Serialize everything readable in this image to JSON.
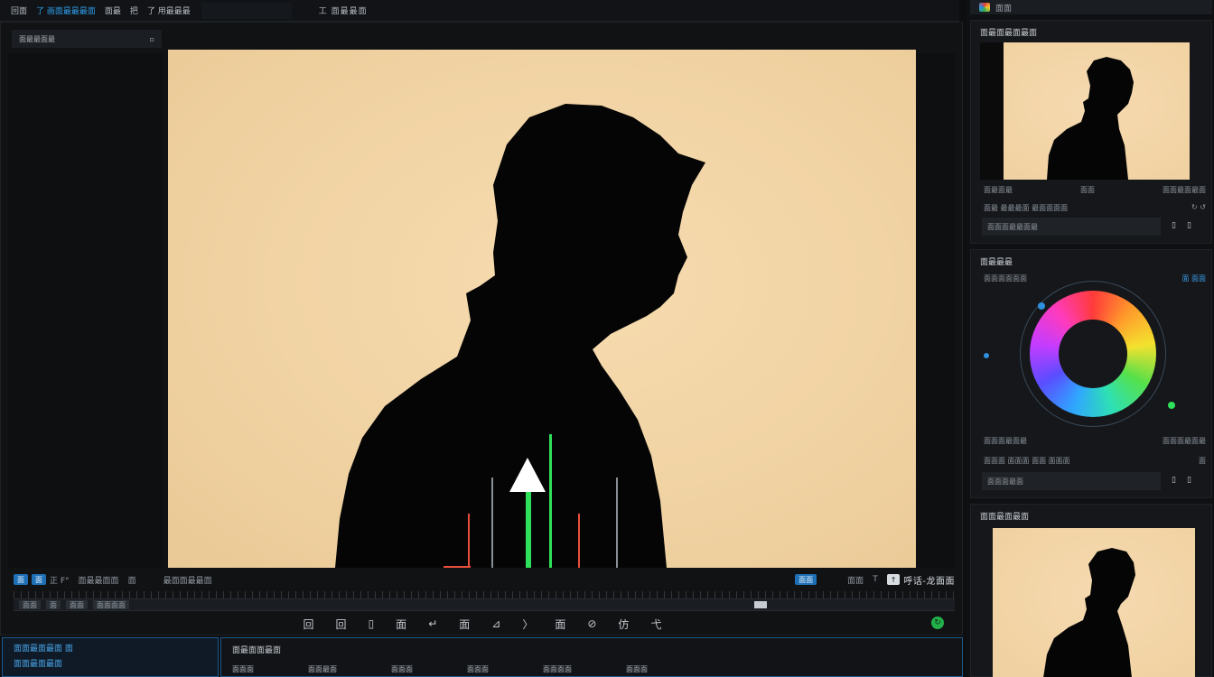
{
  "topbar": {
    "menu": [
      "回面",
      "了 画面最最最面",
      "面最",
      "把",
      "了 用最最最",
      "工 面最最面"
    ],
    "highlight_index": 1
  },
  "viewer": {
    "tab_label": "面最最面最",
    "tab_close": "▫"
  },
  "transport": {
    "chips": [
      "面",
      "面"
    ],
    "labels": [
      "正 F°",
      "面最最面面",
      "面",
      "最面面最最面"
    ],
    "zoom_chip": "面面",
    "right_label": "面面",
    "speed_icon": "T",
    "speed_value": "↑",
    "timecode": "呼话-龙面面",
    "scrub_segments": [
      "面面",
      "面",
      "面面",
      "面面面面"
    ],
    "controls": [
      "回",
      "回",
      "▯",
      "面",
      "↵",
      "面",
      "⊿",
      "〉",
      "面",
      "⊘",
      "仿",
      "弋"
    ],
    "go_icon": "↻"
  },
  "bottom_left": {
    "line1": "面面最面最面 面",
    "line2": "面面最面最面"
  },
  "bottom_mid": {
    "title": "面最面面最面",
    "cells": [
      "面面面",
      "面面最面",
      "面面面",
      "面面面",
      "面面面面",
      "面面面"
    ]
  },
  "sidebar": {
    "header": "面面",
    "panel1": {
      "title": "面最面最面最面",
      "meta": [
        "面最面最",
        "面面",
        "面面最面最面"
      ],
      "toolbar": [
        "面最 最最最面 最面面面面",
        "↻ ↺"
      ],
      "field": "面面面最最面最",
      "field_icons": [
        "▯",
        "▯"
      ]
    },
    "panel2": {
      "title": "面最最最",
      "subtitle": "面面面面面面",
      "blue_label": "面 面面",
      "meta": [
        "面面面最面最",
        "面面面最面最"
      ],
      "toolbar": [
        "面面面 面面面 面面 面面面",
        "面"
      ],
      "field": "面面面最面",
      "field_icons": [
        "▯",
        "▯"
      ]
    },
    "panel3": {
      "title": "面面最面最面"
    }
  },
  "colors": {
    "accent": "#2e9be6",
    "meter_green": "#2ee05a",
    "meter_red": "#e8503c",
    "go_green": "#22b04a"
  }
}
